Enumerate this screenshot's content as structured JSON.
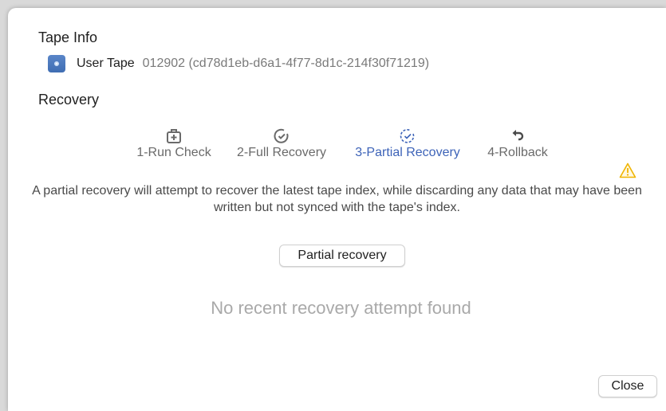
{
  "tape_info": {
    "title": "Tape Info",
    "tape_name": "User Tape",
    "tape_id": "012902 (cd78d1eb-d6a1-4f77-8d1c-214f30f71219)"
  },
  "recovery": {
    "title": "Recovery",
    "steps": [
      {
        "label": "1-Run Check",
        "icon": "medical-kit-icon",
        "active": false
      },
      {
        "label": "2-Full Recovery",
        "icon": "check-circle-icon",
        "active": false
      },
      {
        "label": "3-Partial Recovery",
        "icon": "partial-check-circle-icon",
        "active": true
      },
      {
        "label": "4-Rollback",
        "icon": "rollback-arrow-icon",
        "active": false
      }
    ],
    "description": "A partial recovery will attempt to recover the latest tape index, while discarding any data that may have been written but not synced with the tape's index.",
    "action_label": "Partial recovery",
    "empty_message": "No recent recovery attempt found"
  },
  "footer": {
    "close_label": "Close"
  },
  "colors": {
    "accent": "#3d63b8",
    "warning": "#f0b400"
  }
}
